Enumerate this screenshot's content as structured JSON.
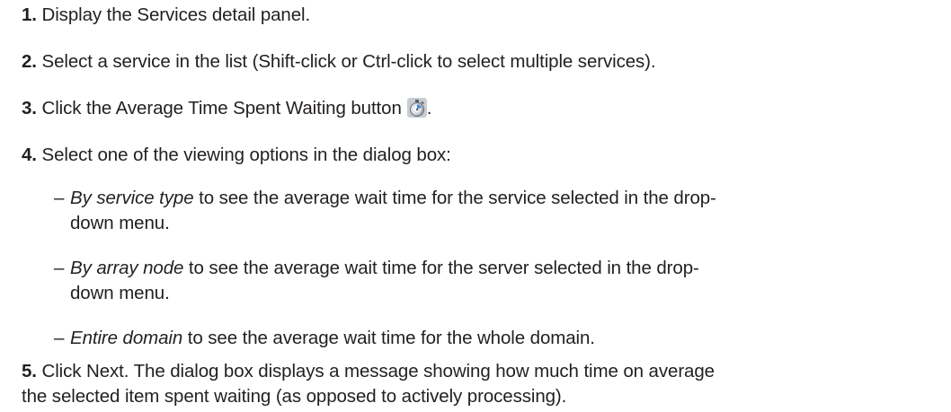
{
  "steps": [
    {
      "num": "1.",
      "text": "Display the Services detail panel."
    },
    {
      "num": "2.",
      "text": "Select a service in the list (Shift-click or Ctrl-click to select multiple services)."
    },
    {
      "num": "3.",
      "text_before": "Click the Average Time Spent Waiting button",
      "icon": "stopwatch-icon",
      "text_after": "."
    },
    {
      "num": "4.",
      "text": "Select one of the viewing options in the dialog box:"
    },
    {
      "num": "5.",
      "line1": "Click Next. The dialog box displays a message showing how much time on average",
      "line2": "the selected item spent waiting (as opposed to actively processing)."
    }
  ],
  "options": [
    {
      "term": "By service type",
      "line1": " to see the average wait time for the service selected in the drop-",
      "line2": "down menu."
    },
    {
      "term": "By array node",
      "line1": " to see the average wait time for the server selected in the drop-",
      "line2": "down menu."
    },
    {
      "term": "Entire domain",
      "line1": " to see the average wait time for the whole domain."
    }
  ],
  "dash": "–"
}
